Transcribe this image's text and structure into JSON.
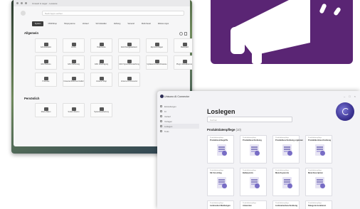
{
  "back_window": {
    "title": "Umsatz & Lager - Lexware",
    "search_placeholder": "Nach Apps suchen",
    "tabs": [
      {
        "label": "System",
        "active": true
      },
      {
        "label": "CMS/Shop",
        "active": false
      },
      {
        "label": "Shopsysteme",
        "active": false
      },
      {
        "label": "Verkauf",
        "active": false
      },
      {
        "label": "Schnittstellen",
        "active": false
      },
      {
        "label": "Zahlung",
        "active": false
      },
      {
        "label": "Versand",
        "active": false
      },
      {
        "label": "Multi-Kanal",
        "active": false
      },
      {
        "label": "Weitere Apps",
        "active": false
      }
    ],
    "section_general": "Allgemein",
    "general_items": [
      {
        "label": "Administration",
        "icon": "user-admin-icon"
      },
      {
        "label": "Archiv",
        "icon": "archive-icon"
      },
      {
        "label": "Dokumente",
        "icon": "document-icon"
      },
      {
        "label": "Einrichtungsassistent",
        "icon": "wand-icon"
      },
      {
        "label": "Export/Anfragen",
        "icon": "export-icon"
      },
      {
        "label": "Marktplatz",
        "icon": "marketplace-icon"
      },
      {
        "label": "GDU Restore",
        "icon": "restore-icon"
      },
      {
        "label": "GDU Sicherung",
        "icon": "backup-icon"
      },
      {
        "label": "GDU Übertragung",
        "icon": "transfer-icon"
      },
      {
        "label": "GDU Systemüberwachung",
        "icon": "monitor-icon"
      },
      {
        "label": "Updates/Versionshinweise",
        "icon": "update-icon"
      },
      {
        "label": "Plug-in Aktualisierung",
        "icon": "plugin-icon"
      },
      {
        "label": "Prozesse",
        "icon": "process-icon"
      },
      {
        "label": "Universal Dokument Editor",
        "icon": "editor-icon"
      },
      {
        "label": "Unisono Shop",
        "icon": "shop-icon"
      },
      {
        "label": "Unisono AI Connector",
        "icon": "ai-connector-icon"
      }
    ],
    "section_personal": "Persönlich",
    "personal_items": [
      {
        "label": "Meine Daten",
        "icon": "my-data-icon"
      },
      {
        "label": "Social Unisono",
        "icon": "social-icon"
      },
      {
        "label": "Systembearbeitung",
        "icon": "system-edit-icon"
      }
    ]
  },
  "front_window": {
    "title": "Unisono AI Connector",
    "sidebar": [
      {
        "label": "Einstellungen",
        "active": false
      },
      {
        "label": "KI",
        "active": false
      },
      {
        "label": "Verlauf",
        "active": false
      },
      {
        "label": "Vorlagen",
        "active": false
      },
      {
        "label": "Loslegen",
        "active": true
      },
      {
        "label": "Tools",
        "active": false
      }
    ],
    "heading": "Loslegen",
    "search_placeholder": "Suchen",
    "section_title": "Produktdatenpflege",
    "section_count": "(10)",
    "cards": [
      {
        "category": "Produktdatenpflege",
        "title": "Produktsuchbegriffe"
      },
      {
        "category": "Produktdatenpflege",
        "title": "Produktbeschreibung"
      },
      {
        "category": "Produktdatenpflege",
        "title": "Produktbeschreibung ergänzen"
      },
      {
        "category": "Produktdatenpflege",
        "title": "Produktkurzbeschreibung"
      },
      {
        "category": "Produktdatenpflege",
        "title": "SE Vorschlag"
      },
      {
        "category": "Produktdatenpflege",
        "title": "Bulletpoints"
      },
      {
        "category": "Produktdatenpflege",
        "title": "Meta Keywords"
      },
      {
        "category": "Produktdatenpflege",
        "title": "Meta Description"
      }
    ],
    "bottom_cards": [
      {
        "category": "Produktdatenpflege",
        "title": "Lieferzeiten Meldungen"
      },
      {
        "category": "Produktdatenpflege",
        "title": "Antworten"
      },
      {
        "category": "Produktdatenpflege",
        "title": "Lieferantenbeschreibung"
      },
      {
        "category": "Produktdatenpflege",
        "title": "Kategorie kuratieren"
      }
    ]
  },
  "colors": {
    "promo_purple": "#5a2574",
    "accent_violet": "#3c3392"
  }
}
